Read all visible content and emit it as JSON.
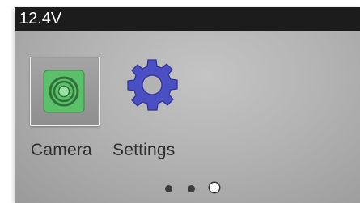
{
  "status_bar": {
    "voltage": "12.4V"
  },
  "apps": [
    {
      "label": "Camera",
      "icon": "camera-icon"
    },
    {
      "label": "Settings",
      "icon": "gear-icon"
    }
  ],
  "pagination": {
    "total": 3,
    "active": 3
  },
  "colors": {
    "status_bar": "#1c1c1c",
    "camera_green": "#5cc06a",
    "gear_blue": "#4a4fc4",
    "screen_bg": "#b3b3b3"
  }
}
